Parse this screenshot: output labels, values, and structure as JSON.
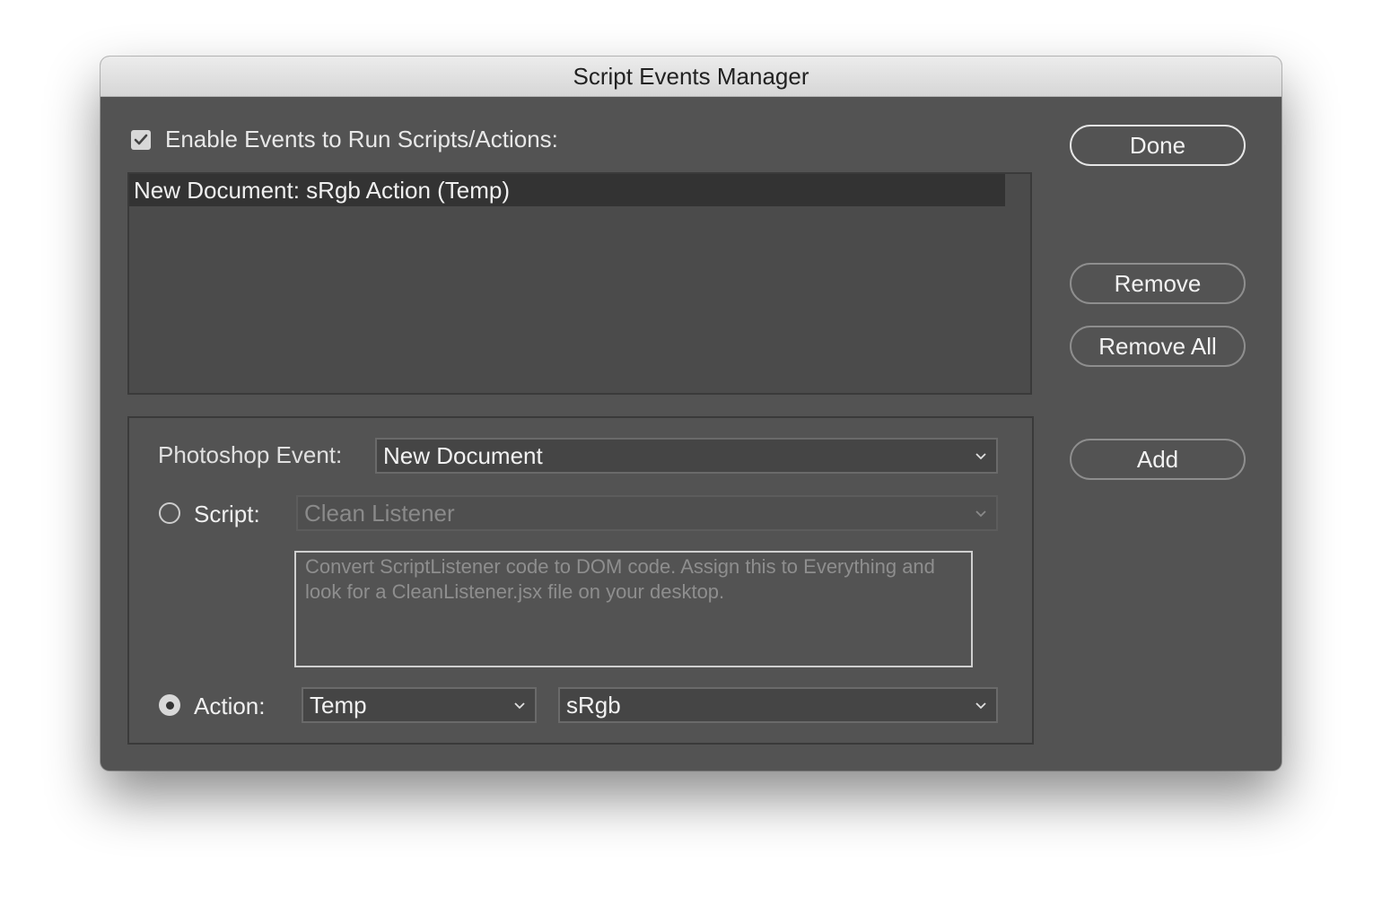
{
  "window": {
    "title": "Script Events Manager"
  },
  "enable": {
    "label": "Enable Events to Run Scripts/Actions:",
    "checked": true
  },
  "event_list": {
    "items": [
      {
        "label": "New Document: sRgb Action (Temp)",
        "selected": true
      }
    ]
  },
  "buttons": {
    "done": "Done",
    "remove": "Remove",
    "remove_all": "Remove All",
    "add": "Add"
  },
  "form": {
    "photoshop_event_label": "Photoshop Event:",
    "photoshop_event_value": "New Document",
    "script_label": "Script:",
    "script_value": "Clean Listener",
    "script_selected": false,
    "script_description": "Convert ScriptListener code to DOM code. Assign this to Everything and look for a CleanListener.jsx file on your desktop.",
    "action_label": "Action:",
    "action_selected": true,
    "action_set_value": "Temp",
    "action_value": "sRgb"
  },
  "icons": {
    "checkbox": "checkmark-icon",
    "dropdown": "chevron-down-icon"
  },
  "colors": {
    "dialog_bg": "#535353",
    "selected_row_bg": "#333333"
  }
}
